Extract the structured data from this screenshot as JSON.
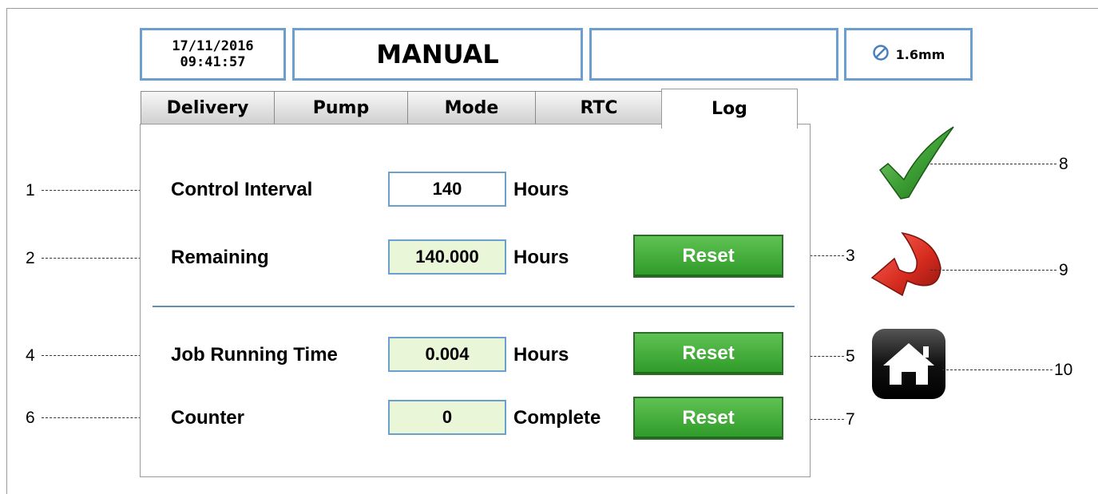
{
  "header": {
    "date": "17/11/2016",
    "time": "09:41:57",
    "mode": "MANUAL",
    "message": "",
    "nozzle_size": "1.6mm"
  },
  "tabs": [
    {
      "label": "Delivery",
      "active": false
    },
    {
      "label": "Pump",
      "active": false
    },
    {
      "label": "Mode",
      "active": false
    },
    {
      "label": "RTC",
      "active": false
    },
    {
      "label": "Log",
      "active": true
    }
  ],
  "log": {
    "control_interval": {
      "label": "Control Interval",
      "value": "140",
      "unit": "Hours"
    },
    "remaining": {
      "label": "Remaining",
      "value": "140.000",
      "unit": "Hours",
      "button": "Reset"
    },
    "job_running_time": {
      "label": "Job Running Time",
      "value": "0.004",
      "unit": "Hours",
      "button": "Reset"
    },
    "counter": {
      "label": "Counter",
      "value": "0",
      "unit": "Complete",
      "button": "Reset"
    }
  },
  "side_buttons": [
    {
      "icon": "checkmark-icon"
    },
    {
      "icon": "back-arrow-icon"
    },
    {
      "icon": "home-icon"
    }
  ],
  "callouts": [
    "1",
    "2",
    "3",
    "4",
    "5",
    "6",
    "7",
    "8",
    "9",
    "10"
  ],
  "colors": {
    "box_border": "#6a9fd0",
    "readonly_field": "#e9f6d8",
    "reset_button": "#3daa35",
    "check": "#2e9a28",
    "arrow": "#d42a1e"
  }
}
